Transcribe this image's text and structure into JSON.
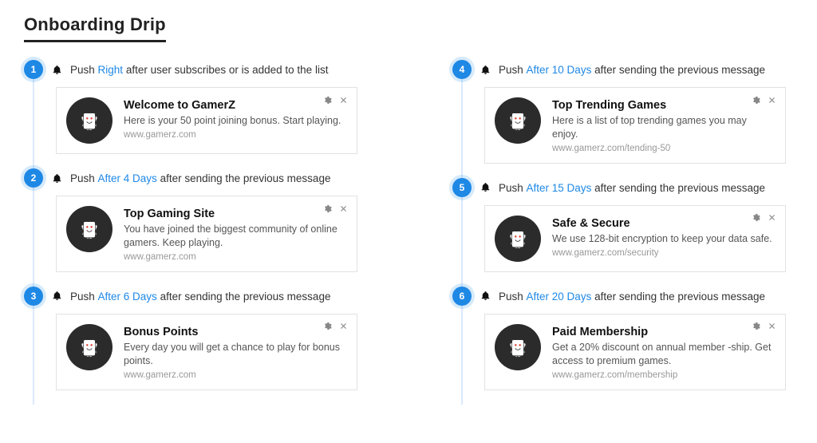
{
  "title": "Onboarding Drip",
  "push_label": "Push",
  "suffix_first": "after user subscribes or is added to the list",
  "suffix_rest": "after sending the previous message",
  "columns": [
    {
      "steps": [
        {
          "n": "1",
          "timing": "Right",
          "suffix_key": "first",
          "card": {
            "title": "Welcome to GamerZ",
            "desc": "Here is your 50 point joining bonus. Start playing.",
            "url": "www.gamerz.com"
          }
        },
        {
          "n": "2",
          "timing": "After 4 Days",
          "suffix_key": "rest",
          "card": {
            "title": "Top Gaming Site",
            "desc": "You have joined the biggest community of online gamers. Keep playing.",
            "url": "www.gamerz.com"
          }
        },
        {
          "n": "3",
          "timing": "After 6 Days",
          "suffix_key": "rest",
          "card": {
            "title": "Bonus Points",
            "desc": "Every day you will get a chance to play for bonus points.",
            "url": "www.gamerz.com"
          }
        }
      ]
    },
    {
      "steps": [
        {
          "n": "4",
          "timing": "After 10 Days",
          "suffix_key": "rest",
          "card": {
            "title": "Top Trending Games",
            "desc": "Here is a list of top trending games you may enjoy.",
            "url": "www.gamerz.com/tending-50"
          }
        },
        {
          "n": "5",
          "timing": "After 15 Days",
          "suffix_key": "rest",
          "card": {
            "title": "Safe & Secure",
            "desc": "We use 128-bit encryption to keep your data safe.",
            "url": "www.gamerz.com/security"
          }
        },
        {
          "n": "6",
          "timing": "After 20 Days",
          "suffix_key": "rest",
          "card": {
            "title": "Paid Membership",
            "desc": "Get a 20% discount on annual member -ship. Get access to premium games.",
            "url": "www.gamerz.com/membership"
          }
        }
      ]
    }
  ]
}
